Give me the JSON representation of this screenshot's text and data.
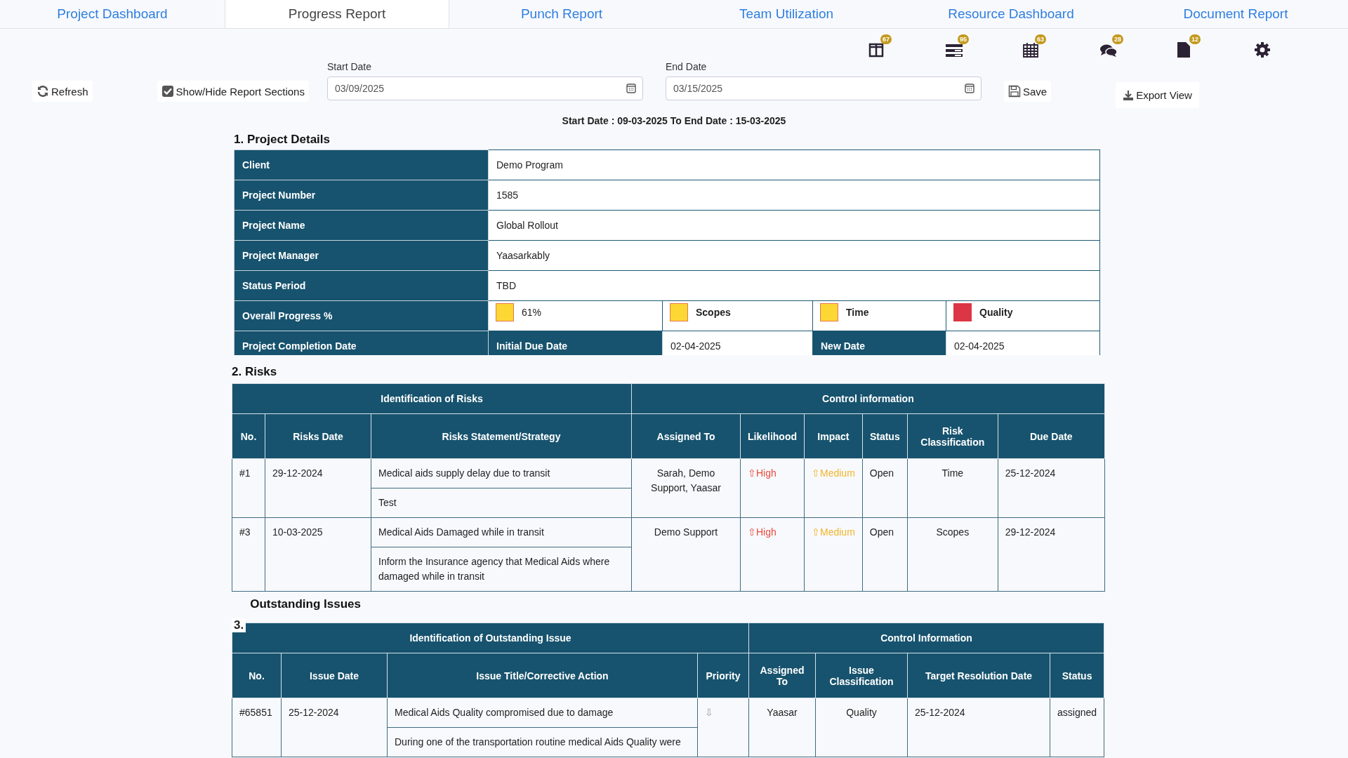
{
  "tabs": [
    {
      "label": "Project Dashboard",
      "selected": false
    },
    {
      "label": "Progress Report",
      "selected": true
    },
    {
      "label": "Punch Report",
      "selected": false
    },
    {
      "label": "Team Utilization",
      "selected": false
    },
    {
      "label": "Resource Dashboard",
      "selected": false
    },
    {
      "label": "Document Report",
      "selected": false
    }
  ],
  "toolbar_icons": [
    {
      "kind": "columns",
      "badge": "67"
    },
    {
      "kind": "list",
      "badge": "95"
    },
    {
      "kind": "calendar",
      "badge": "63"
    },
    {
      "kind": "comments",
      "badge": "28"
    },
    {
      "kind": "file",
      "badge": "12"
    },
    {
      "kind": "settings"
    }
  ],
  "controls": {
    "refresh": "Refresh",
    "show_hide": {
      "label": "Show/Hide Report Sections",
      "checked": true
    },
    "start_date": {
      "label": "Start Date",
      "value": "03/09/2025"
    },
    "end_date": {
      "label": "End Date",
      "value": "03/15/2025"
    },
    "save": "Save",
    "export": "Export View"
  },
  "date_summary": "Start Date : 09-03-2025 To End Date : 15-03-2025",
  "project_details": {
    "heading": "1. Project Details",
    "rows": [
      {
        "label": "Client",
        "value": "Demo Program"
      },
      {
        "label": "Project Number",
        "value": "1585"
      },
      {
        "label": "Project Name",
        "value": "Global Rollout"
      },
      {
        "label": "Project Manager",
        "value": "Yaasarkably"
      },
      {
        "label": "Status Period",
        "value": "TBD"
      }
    ],
    "progress": {
      "label": "Overall Progress %",
      "items": [
        {
          "text": "61%",
          "color": "#fdd835"
        },
        {
          "text": "Scopes",
          "color": "#fdd835"
        },
        {
          "text": "Time",
          "color": "#fdd835"
        },
        {
          "text": "Quality",
          "color": "#dc3545"
        }
      ]
    },
    "completion": {
      "label": "Project Completion Date",
      "initial_label": "Initial Due Date",
      "initial_value": "02-04-2025",
      "new_label": "New Date",
      "new_value": "02-04-2025"
    }
  },
  "risks": {
    "heading": "2. Risks",
    "groups": [
      {
        "label": "Identification of Risks"
      },
      {
        "label": "Control information"
      }
    ],
    "columns": [
      "No.",
      "Risks Date",
      "Risks Statement/Strategy",
      "Assigned To",
      "Likelihood",
      "Impact",
      "Status",
      "Risk Classification",
      "Due Date"
    ],
    "rows": [
      {
        "no": "#1",
        "date": "29-12-2024",
        "statements": [
          "Medical aids supply delay due to transit",
          "Test"
        ],
        "assigned_to": "Sarah, Demo Support, Yaasar",
        "likelihood": {
          "text": "⇧High",
          "kind": "high"
        },
        "impact": {
          "text": "⇧Medium",
          "kind": "medium"
        },
        "status": "Open",
        "classification": "Time",
        "due_date": "25-12-2024"
      },
      {
        "no": "#3",
        "date": "10-03-2025",
        "statements": [
          "Medical Aids Damaged while in transit",
          "Inform the Insurance agency that Medical Aids where damaged while in transit"
        ],
        "assigned_to": "Demo Support",
        "likelihood": {
          "text": "⇧High",
          "kind": "high"
        },
        "impact": {
          "text": "⇧Medium",
          "kind": "medium"
        },
        "status": "Open",
        "classification": "Scopes",
        "due_date": "29-12-2024"
      }
    ]
  },
  "issues": {
    "number": "3.",
    "heading": "Outstanding Issues",
    "groups": [
      {
        "label": "Identification of Outstanding Issue"
      },
      {
        "label": "Control Information"
      }
    ],
    "columns": [
      "No.",
      "Issue Date",
      "Issue Title/Corrective Action",
      "Priority",
      "Assigned To",
      "Issue Classification",
      "Target Resolution Date",
      "Status"
    ],
    "rows": [
      {
        "no": "#65851",
        "date": "25-12-2024",
        "statements": [
          "Medical Aids Quality compromised due to damage",
          "During one of the transportation routine medical Aids Quality were"
        ],
        "priority": {
          "text": "⇩",
          "kind": "low"
        },
        "assigned_to": "Yaasar",
        "classification": "Quality",
        "target_date": "25-12-2024",
        "status": "assigned"
      }
    ]
  }
}
